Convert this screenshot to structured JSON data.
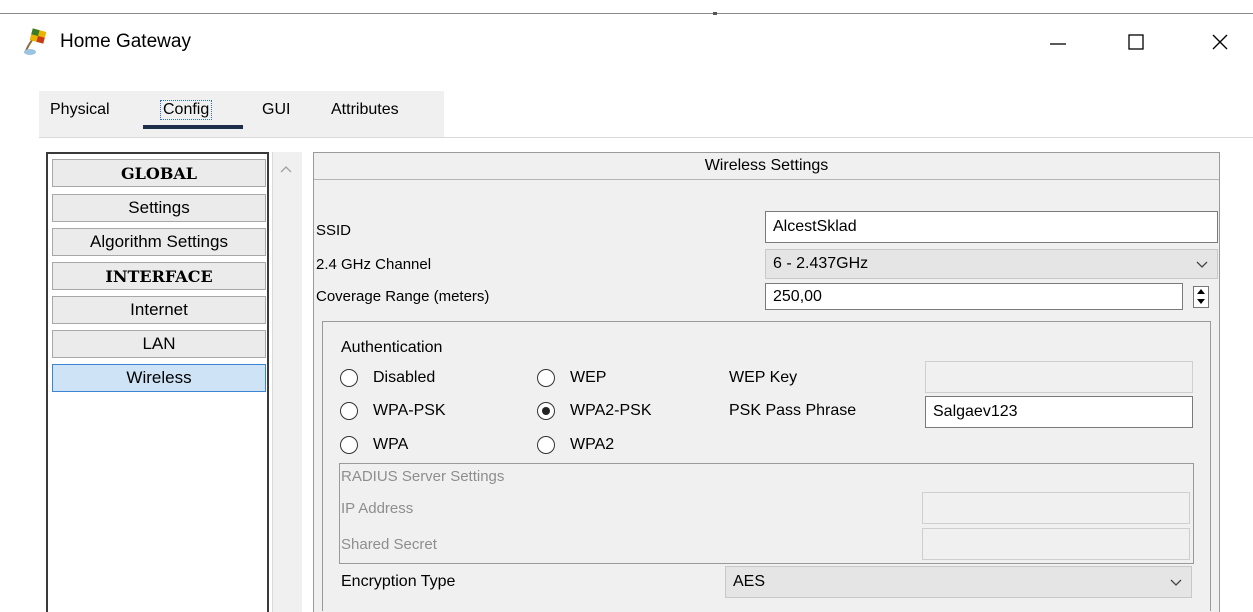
{
  "window": {
    "title": "Home Gateway",
    "controls": [
      "minimize",
      "maximize",
      "close"
    ]
  },
  "tabs": [
    {
      "label": "Physical",
      "active": false
    },
    {
      "label": "Config",
      "active": true
    },
    {
      "label": "GUI",
      "active": false
    },
    {
      "label": "Attributes",
      "active": false
    }
  ],
  "sidebar": {
    "items": [
      {
        "label": "GLOBAL",
        "type": "header"
      },
      {
        "label": "Settings",
        "type": "item"
      },
      {
        "label": "Algorithm Settings",
        "type": "item"
      },
      {
        "label": "INTERFACE",
        "type": "header"
      },
      {
        "label": "Internet",
        "type": "item"
      },
      {
        "label": "LAN",
        "type": "item"
      },
      {
        "label": "Wireless",
        "type": "item",
        "selected": true
      }
    ]
  },
  "wireless": {
    "header": "Wireless Settings",
    "ssid": {
      "label": "SSID",
      "value": "AlcestSklad"
    },
    "channel": {
      "label": "2.4 GHz Channel",
      "value": "6 - 2.437GHz"
    },
    "coverage": {
      "label": "Coverage Range (meters)",
      "value": "250,00"
    },
    "authentication": {
      "title": "Authentication",
      "options": [
        {
          "label": "Disabled",
          "selected": false
        },
        {
          "label": "WEP",
          "selected": false
        },
        {
          "label": "WPA-PSK",
          "selected": false
        },
        {
          "label": "WPA2-PSK",
          "selected": true
        },
        {
          "label": "WPA",
          "selected": false
        },
        {
          "label": "WPA2",
          "selected": false
        }
      ],
      "wep_key_label": "WEP Key",
      "wep_key_value": "",
      "psk_label": "PSK Pass Phrase",
      "psk_value": "Salgaev123"
    },
    "radius": {
      "title": "RADIUS Server Settings",
      "ip_label": "IP Address",
      "ip_value": "",
      "secret_label": "Shared Secret",
      "secret_value": ""
    },
    "encryption": {
      "label": "Encryption Type",
      "value": "AES"
    }
  },
  "colors": {
    "selected_item_bg": "#cfe3f7",
    "selected_item_border": "#3d83d0",
    "active_tab_underline": "#1c2e4a"
  }
}
